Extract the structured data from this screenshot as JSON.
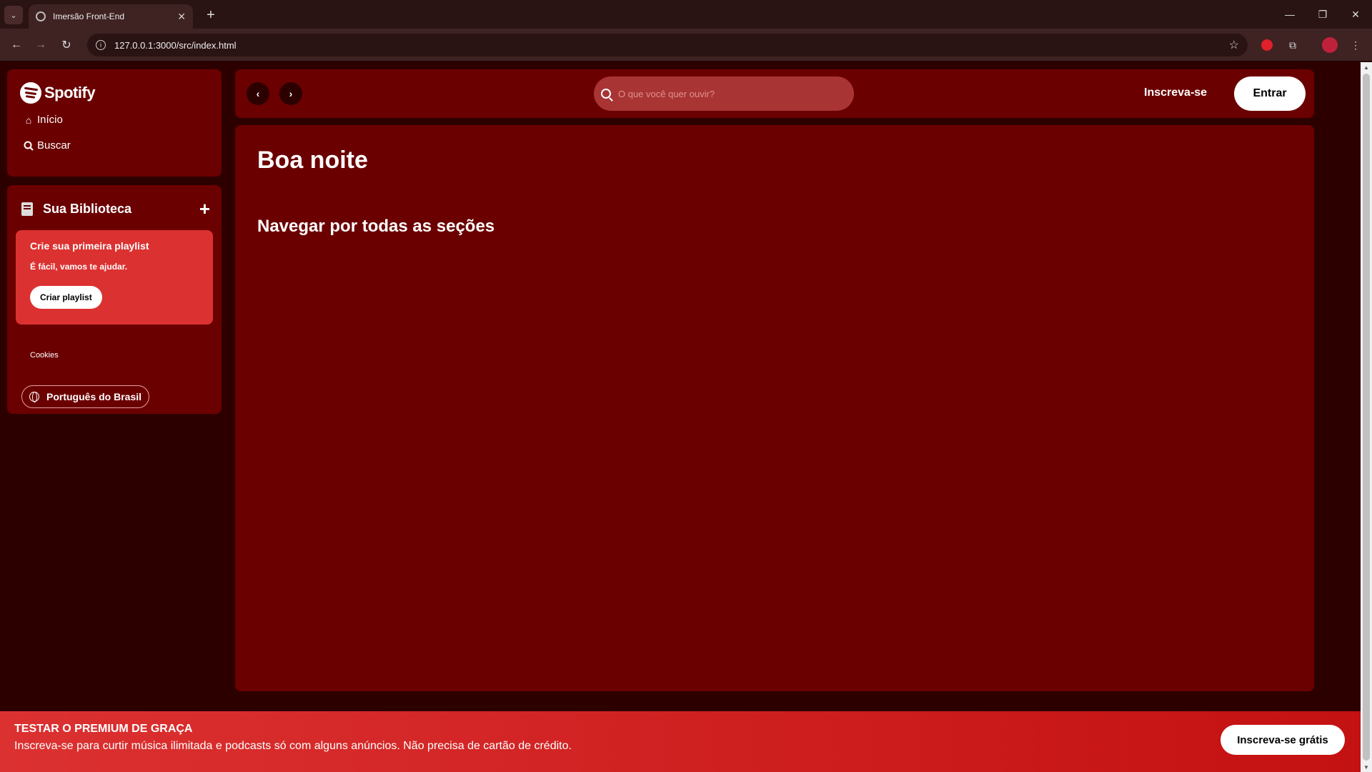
{
  "browser": {
    "tab_title": "Imersão Front-End",
    "tab_close": "✕",
    "new_tab": "+",
    "url": "127.0.0.1:3000/src/index.html",
    "window_controls": {
      "minimize": "—",
      "restore": "❐",
      "close": "✕"
    },
    "nav": {
      "back": "←",
      "forward": "→",
      "reload": "↻"
    }
  },
  "sidebar": {
    "logo_text": "Spotify",
    "nav_items": [
      {
        "label": "Início",
        "icon": "home-icon"
      },
      {
        "label": "Buscar",
        "icon": "search-icon"
      }
    ],
    "library": {
      "title": "Sua Biblioteca",
      "add_symbol": "+",
      "playlist_card": {
        "title": "Crie sua primeira playlist",
        "subtitle": "É fácil, vamos te ajudar.",
        "button": "Criar playlist"
      },
      "cookies_link": "Cookies",
      "language_button": "Português do Brasil"
    }
  },
  "header": {
    "back_arrow": "‹",
    "forward_arrow": "›",
    "search_placeholder": "O que você quer ouvir?",
    "signup": "Inscreva-se",
    "login": "Entrar"
  },
  "main": {
    "greeting": "Boa noite",
    "section_title": "Navegar por todas as seções"
  },
  "banner": {
    "title": "TESTAR O PREMIUM DE GRAÇA",
    "text": "Inscreva-se para curtir música ilimitada e podcasts só com alguns anúncios. Não precisa de cartão de crédito.",
    "button": "Inscreva-se grátis"
  },
  "colors": {
    "page_bg": "#2d0000",
    "panel_bg": "#6b0000",
    "accent_red": "#dc3131",
    "search_bg": "#a93434"
  }
}
